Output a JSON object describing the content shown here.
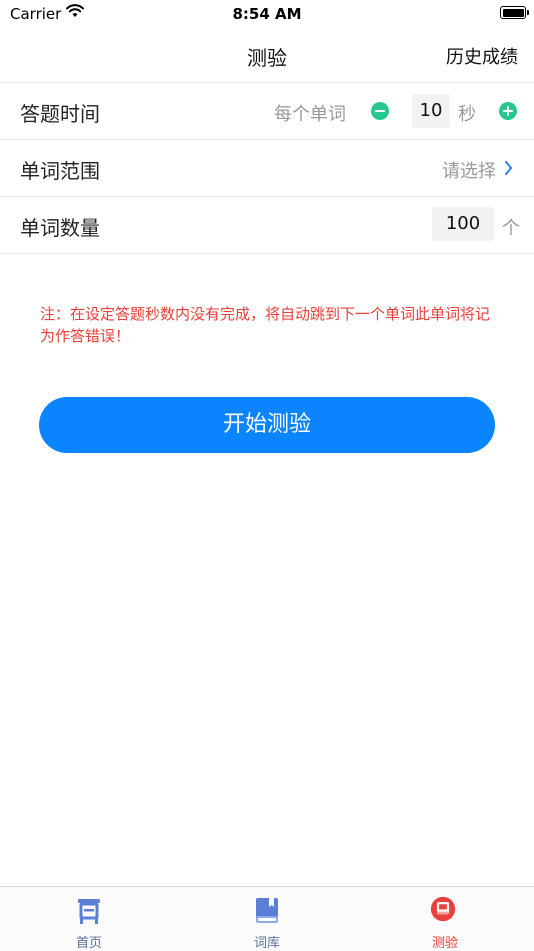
{
  "status_bar": {
    "carrier": "Carrier",
    "time": "8:54 AM"
  },
  "nav": {
    "title": "测验",
    "right_action": "历史成绩"
  },
  "rows": {
    "answer_time": {
      "label": "答题时间",
      "per_word": "每个单词",
      "value": "10",
      "unit": "秒"
    },
    "word_range": {
      "label": "单词范围",
      "value": "请选择"
    },
    "word_count": {
      "label": "单词数量",
      "value": "100",
      "unit": "个"
    }
  },
  "note": "注：在设定答题秒数内没有完成，将自动跳到下一个单词此单词将记为作答错误！",
  "start_button": "开始测验",
  "tabs": [
    {
      "label": "首页",
      "icon": "home-icon",
      "active": false
    },
    {
      "label": "词库",
      "icon": "book-icon",
      "active": false
    },
    {
      "label": "测验",
      "icon": "test-icon",
      "active": true
    }
  ],
  "colors": {
    "accent": "#0a84ff",
    "warning": "#e8403a",
    "stepper": "#27c78e",
    "tab_inactive": "#5a6e9a"
  }
}
